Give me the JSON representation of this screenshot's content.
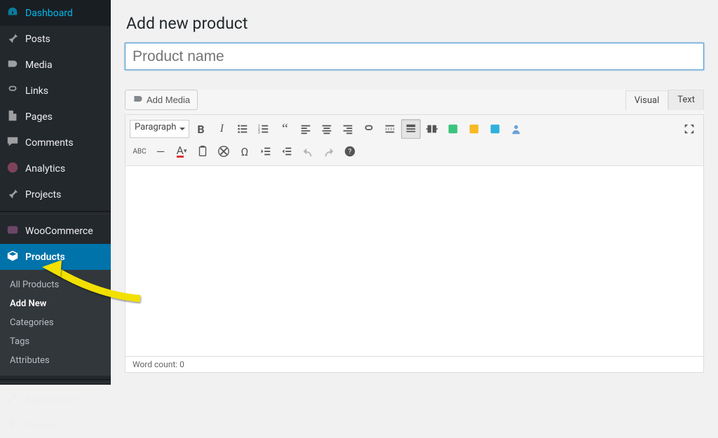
{
  "sidebar": {
    "items": [
      {
        "label": "Dashboard",
        "icon": "dashboard"
      },
      {
        "label": "Posts",
        "icon": "pin"
      },
      {
        "label": "Media",
        "icon": "media"
      },
      {
        "label": "Links",
        "icon": "link"
      },
      {
        "label": "Pages",
        "icon": "page"
      },
      {
        "label": "Comments",
        "icon": "comment"
      },
      {
        "label": "Analytics",
        "icon": "analytics"
      },
      {
        "label": "Projects",
        "icon": "pin"
      },
      {
        "label": "WooCommerce",
        "icon": "woo"
      },
      {
        "label": "Products",
        "icon": "box",
        "active": true
      },
      {
        "label": "Appearance",
        "icon": "brush"
      },
      {
        "label": "Plugins",
        "icon": "plug"
      }
    ],
    "submenu": [
      {
        "label": "All Products"
      },
      {
        "label": "Add New",
        "current": true
      },
      {
        "label": "Categories"
      },
      {
        "label": "Tags"
      },
      {
        "label": "Attributes"
      }
    ]
  },
  "page": {
    "title": "Add new product",
    "name_placeholder": "Product name"
  },
  "editor": {
    "add_media": "Add Media",
    "tab_visual": "Visual",
    "tab_text": "Text",
    "format_select": "Paragraph",
    "word_count": "Word count: 0"
  }
}
